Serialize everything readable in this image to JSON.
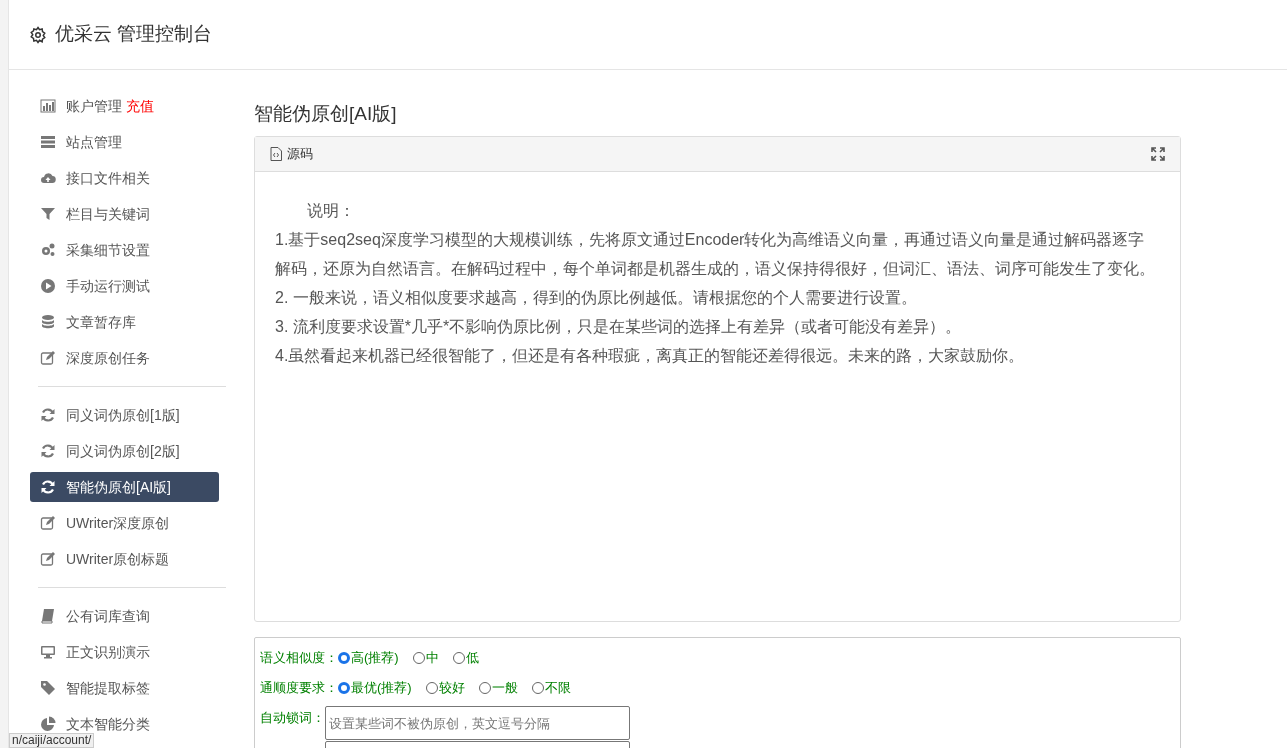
{
  "header": {
    "title": "优采云 管理控制台"
  },
  "sidebar": {
    "groups": [
      [
        {
          "label": "账户管理",
          "badge": "充值",
          "selected": false
        },
        {
          "label": "站点管理",
          "selected": false
        },
        {
          "label": "接口文件相关",
          "selected": false
        },
        {
          "label": "栏目与关键词",
          "selected": false
        },
        {
          "label": "采集细节设置",
          "selected": false
        },
        {
          "label": "手动运行测试",
          "selected": false
        },
        {
          "label": "文章暂存库",
          "selected": false
        },
        {
          "label": "深度原创任务",
          "selected": false
        }
      ],
      [
        {
          "label": "同义词伪原创[1版]",
          "selected": false
        },
        {
          "label": "同义词伪原创[2版]",
          "selected": false
        },
        {
          "label": "智能伪原创[AI版]",
          "selected": true
        },
        {
          "label": "UWriter深度原创",
          "selected": false
        },
        {
          "label": "UWriter原创标题",
          "selected": false
        }
      ],
      [
        {
          "label": "公有词库查询",
          "selected": false
        },
        {
          "label": "正文识别演示",
          "selected": false
        },
        {
          "label": "智能提取标签",
          "selected": false
        },
        {
          "label": "文本智能分类",
          "selected": false
        }
      ]
    ]
  },
  "main": {
    "title": "智能伪原创[AI版]",
    "editor": {
      "toolbar_button": "源码",
      "paragraphs": [
        "说明：",
        "1.基于seq2seq深度学习模型的大规模训练，先将原文通过Encoder转化为高维语义向量，再通过语义向量是通过解码器逐字解码，还原为自然语言。在解码过程中，每个单词都是机器生成的，语义保持得很好，但词汇、语法、词序可能发生了变化。",
        "2. 一般来说，语义相似度要求越高，得到的伪原比例越低。请根据您的个人需要进行设置。",
        "3. 流利度要求设置*几乎*不影响伪原比例，只是在某些词的选择上有差异（或者可能没有差异）。",
        "4.虽然看起来机器已经很智能了，但还是有各种瑕疵，离真正的智能还差得很远。未来的路，大家鼓励你。"
      ]
    },
    "options": [
      {
        "kind": "radios",
        "label": "语义相似度：",
        "choices": [
          {
            "label": "高(推荐)",
            "selected": true
          },
          {
            "label": "中",
            "selected": false
          },
          {
            "label": "低",
            "selected": false
          }
        ]
      },
      {
        "kind": "radios",
        "label": "通顺度要求：",
        "choices": [
          {
            "label": "最优(推荐)",
            "selected": true
          },
          {
            "label": "较好",
            "selected": false
          },
          {
            "label": "一般",
            "selected": false
          },
          {
            "label": "不限",
            "selected": false
          }
        ]
      },
      {
        "kind": "text",
        "label": "自动锁词：",
        "placeholder": "设置某些词不被伪原创，英文逗号分隔"
      }
    ]
  },
  "status_bar": {
    "url": "n/caiji/account/"
  }
}
